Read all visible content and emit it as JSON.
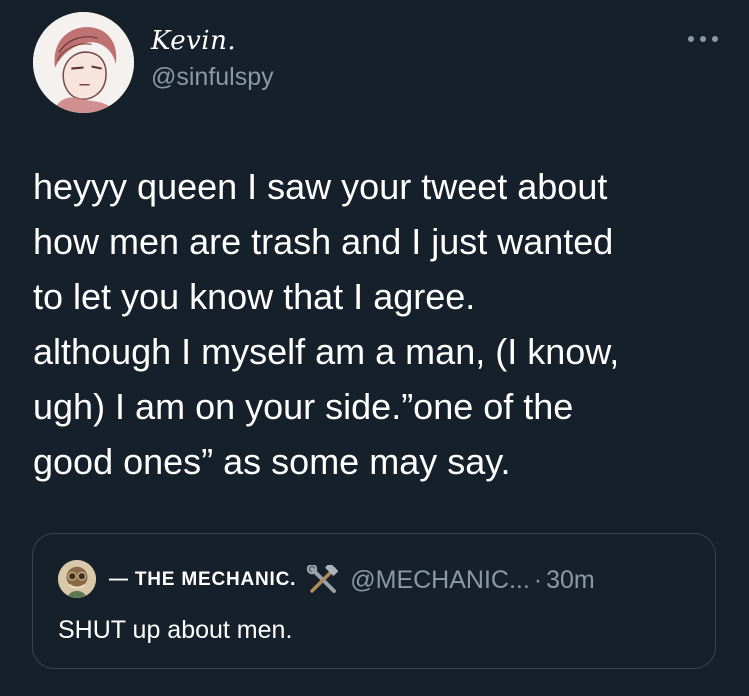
{
  "tweet": {
    "author": {
      "display_name": "Kevin.",
      "handle": "@sinfulspy",
      "avatar_icon": "anime-sketch-avatar"
    },
    "more_icon": "more-horizontal-icon",
    "text": "heyyy queen I saw your tweet about\nhow men are trash and I just wanted\nto let you know that I agree.\nalthough I myself am a man, (I know,\nugh) I am on your side.”one of the\ngood ones” as some may say.",
    "quoted": {
      "display_name": "— THE MECHANIC.",
      "emoji_icon": "hammer-and-wrench-icon",
      "handle": "@MECHANIC...",
      "separator": "·",
      "time": "30m",
      "text": "SHUT up about men.",
      "avatar_icon": "character-avatar"
    }
  },
  "colors": {
    "background": "#15202b",
    "text_primary": "#ffffff",
    "text_secondary": "#8b98a5",
    "border": "#38444d"
  }
}
